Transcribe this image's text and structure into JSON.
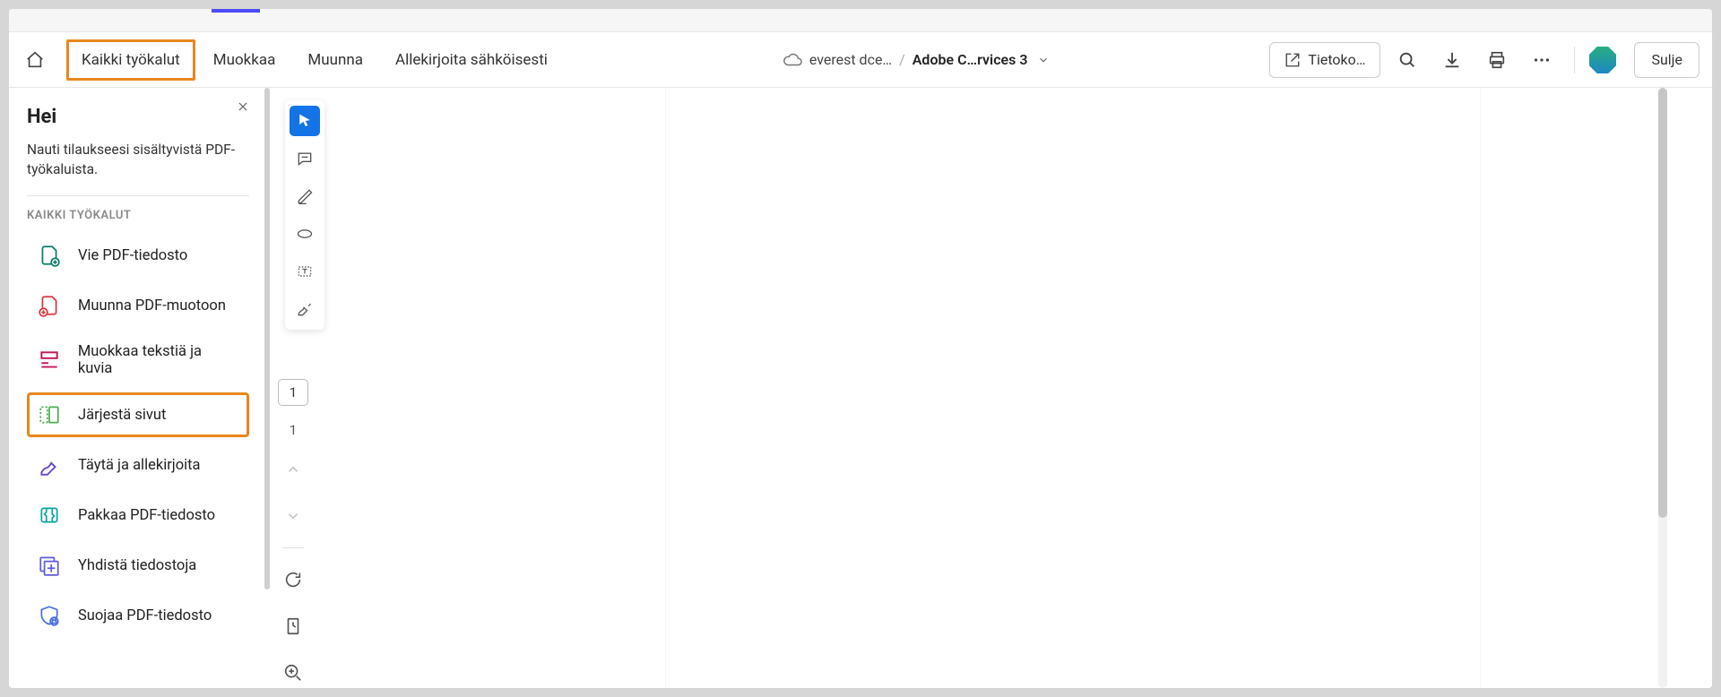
{
  "topbar": {
    "menu": {
      "all_tools": "Kaikki työkalut",
      "edit": "Muokkaa",
      "convert": "Muunna",
      "esign": "Allekirjoita sähköisesti"
    },
    "breadcrumb": {
      "cloud_name": "everest dce…",
      "doc_name": "Adobe C…rvices 3"
    },
    "actions": {
      "share_label": "Tietoko…",
      "close_label": "Sulje"
    }
  },
  "left_panel": {
    "title": "Hei",
    "subtitle": "Nauti tilaukseesi sisältyvistä PDF-työkaluista.",
    "section_heading": "KAIKKI TYÖKALUT",
    "tools": [
      {
        "label": "Vie PDF-tiedosto"
      },
      {
        "label": "Muunna PDF-muotoon"
      },
      {
        "label": "Muokkaa tekstiä ja kuvia"
      },
      {
        "label": "Järjestä sivut"
      },
      {
        "label": "Täytä ja allekirjoita"
      },
      {
        "label": "Pakkaa PDF-tiedosto"
      },
      {
        "label": "Yhdistä tiedostoja"
      },
      {
        "label": "Suojaa PDF-tiedosto"
      }
    ]
  },
  "right_rail": {
    "current_page": "1",
    "total_pages": "1"
  },
  "colors": {
    "highlight": "#e8871e",
    "primary": "#1473e6"
  }
}
